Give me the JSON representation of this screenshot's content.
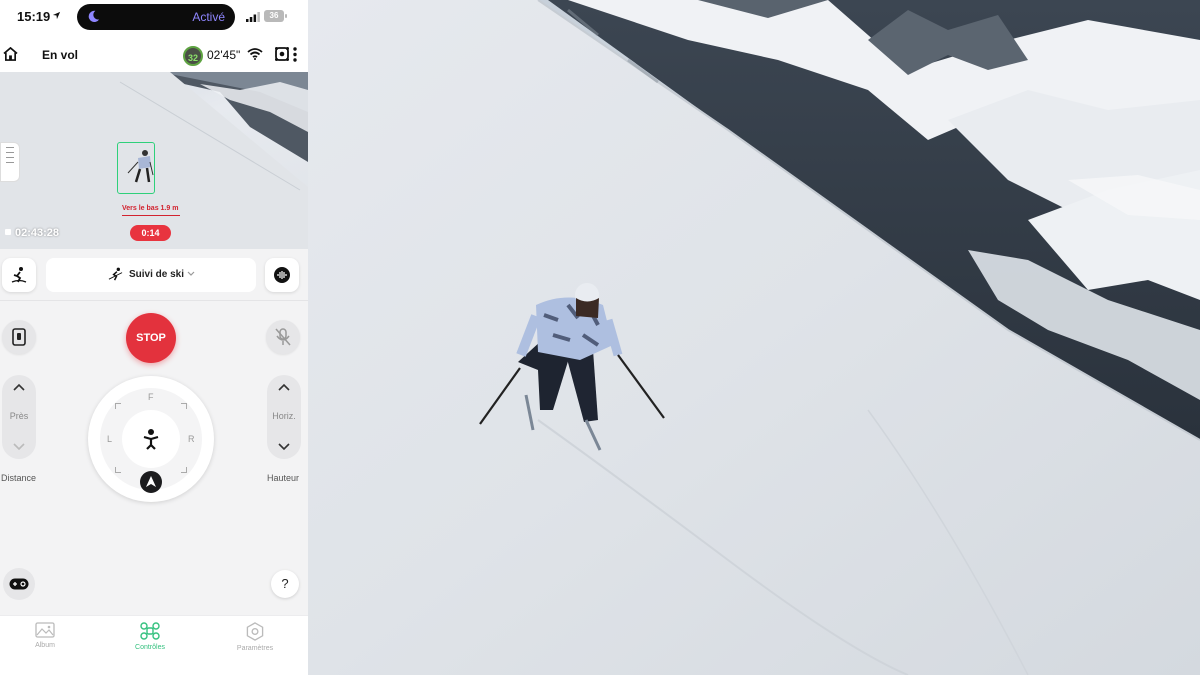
{
  "status_bar": {
    "time": "15:19",
    "focus_label": "Activé",
    "battery": "36"
  },
  "top_bar": {
    "flight_status": "En vol",
    "satellites": "32",
    "flight_time": "02'45\""
  },
  "preview": {
    "distance_label": "Vers le bas 1.9 m",
    "recording_time": "02:43:28",
    "timer": "0:14"
  },
  "mode": {
    "label": "Suivi de ski"
  },
  "controls": {
    "stop_label": "STOP",
    "left_stepper": {
      "label": "Près",
      "caption": "Distance"
    },
    "right_stepper": {
      "label": "Horiz.",
      "caption": "Hauteur"
    },
    "dpad": {
      "front": "F",
      "left": "L",
      "right": "R"
    },
    "help_label": "?"
  },
  "tabs": [
    {
      "label": "Album",
      "active": false
    },
    {
      "label": "Contrôles",
      "active": true
    },
    {
      "label": "Paramètres",
      "active": false
    }
  ],
  "colors": {
    "accent": "#35c17f",
    "stop": "#e3323d",
    "tracking_box": "#2ed07a"
  }
}
